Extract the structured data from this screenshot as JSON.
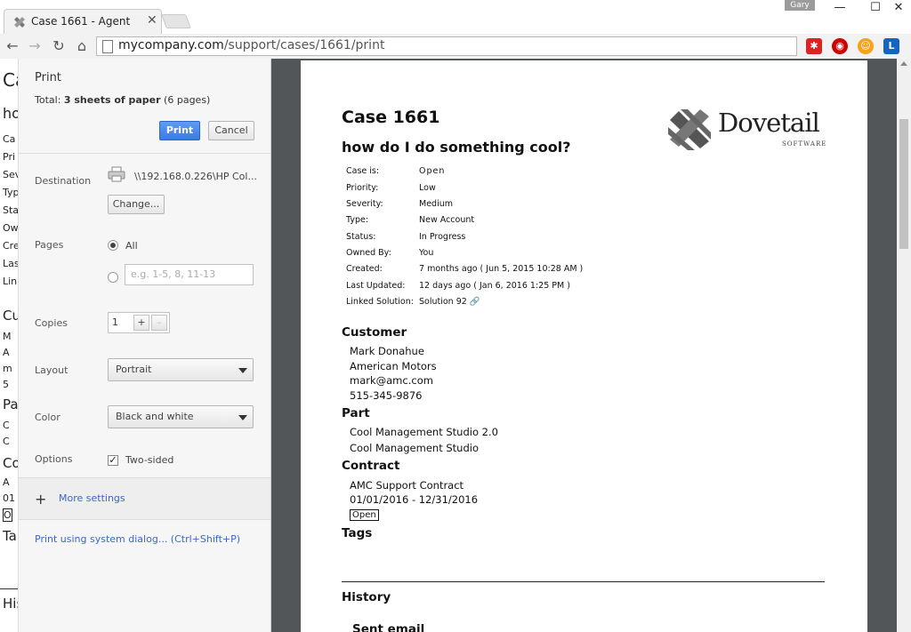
{
  "browser": {
    "tab_title": "Case 1661 - Agent",
    "user_name": "Gary",
    "url_host": "mycompany.com",
    "url_path": "/support/cases/1661/print"
  },
  "underlying_page": {
    "title_fragment": "Ca",
    "subtitle_fragment": "ho",
    "fragments": [
      "Ca",
      "Pri",
      "Sev",
      "Typ",
      "Sta",
      "Ow",
      "Cre",
      "Las",
      "Lin"
    ],
    "section_fragments": [
      "Cu",
      "M",
      "A",
      "m",
      "5",
      "Pa",
      "C",
      "C",
      "Co",
      "A",
      "01",
      "O",
      "Ta",
      "His"
    ]
  },
  "print_panel": {
    "title": "Print",
    "total_prefix": "Total: ",
    "total_bold": "3 sheets of paper",
    "total_suffix": " (6 pages)",
    "print_label": "Print",
    "cancel_label": "Cancel",
    "destination_label": "Destination",
    "destination_value": "\\\\192.168.0.226\\HP Col...",
    "change_label": "Change...",
    "pages_label": "Pages",
    "pages_all": "All",
    "pages_placeholder": "e.g. 1-5, 8, 11-13",
    "copies_label": "Copies",
    "copies_value": "1",
    "layout_label": "Layout",
    "layout_value": "Portrait",
    "color_label": "Color",
    "color_value": "Black and white",
    "options_label": "Options",
    "two_sided_label": "Two-sided",
    "more_settings": "More settings",
    "system_dialog": "Print using system dialog... (Ctrl+Shift+P)"
  },
  "document": {
    "case_title": "Case 1661",
    "case_subtitle": "how do I do something cool?",
    "logo_word": "Dovetail",
    "logo_sub": "SOFTWARE",
    "attributes": [
      {
        "label": "Case is:",
        "value": "Open"
      },
      {
        "label": "Priority:",
        "value": "Low"
      },
      {
        "label": "Severity:",
        "value": "Medium"
      },
      {
        "label": "Type:",
        "value": "New Account"
      },
      {
        "label": "Status:",
        "value": "In Progress"
      },
      {
        "label": "Owned By:",
        "value": "You"
      },
      {
        "label": "Created:",
        "value": "7 months ago ( Jun 5, 2015 10:28 AM )"
      },
      {
        "label": "Last Updated:",
        "value": "12 days ago ( Jan 6, 2016 1:25 PM )"
      },
      {
        "label": "Linked Solution:",
        "value": "Solution 92 🔗"
      }
    ],
    "customer_title": "Customer",
    "customer_lines": [
      "Mark Donahue",
      "American Motors",
      "mark@amc.com",
      "515-345-9876"
    ],
    "part_title": "Part",
    "part_lines": [
      "Cool Management Studio 2.0",
      "Cool Management Studio"
    ],
    "contract_title": "Contract",
    "contract_lines": [
      "AMC Support Contract",
      "01/01/2016 - 12/31/2016"
    ],
    "contract_badge": "Open",
    "tags_title": "Tags",
    "history_title": "History",
    "history_first": "Sent email"
  }
}
